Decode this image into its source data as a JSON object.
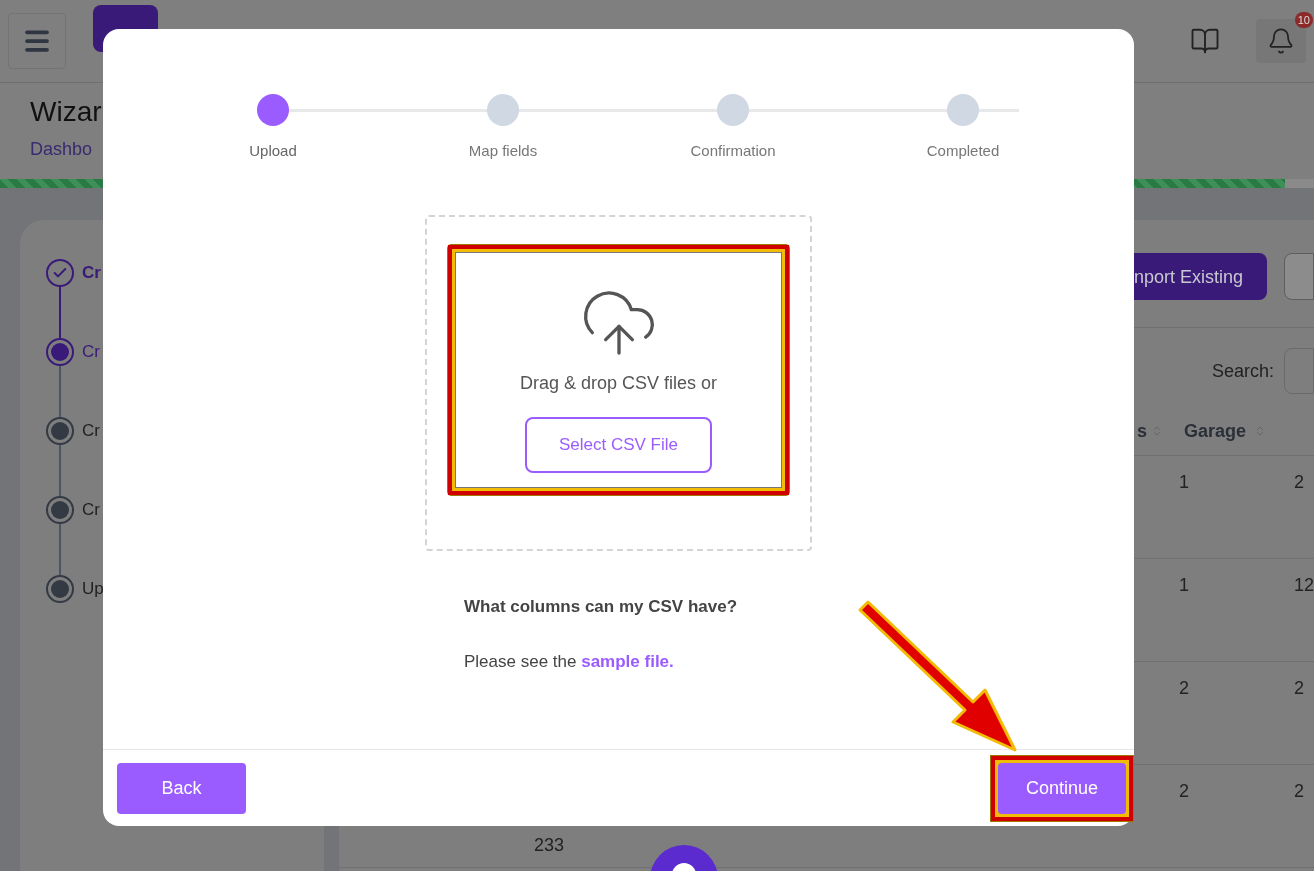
{
  "header": {
    "notification_badge": "10"
  },
  "page": {
    "title": "Wizar",
    "breadcrumb": "Dashbo",
    "progress": {
      "level": 0.978
    }
  },
  "sidebar": {
    "steps": [
      {
        "label": "Cr",
        "kind": "completed"
      },
      {
        "label": "Cr",
        "kind": "current"
      },
      {
        "label": "Cr",
        "kind": "pending"
      },
      {
        "label": "Cr",
        "kind": "pending"
      },
      {
        "label": "Up",
        "kind": "pending"
      }
    ]
  },
  "content": {
    "import_button": "nport Existing",
    "search_label": "Search:",
    "table": {
      "columns": [
        "s",
        "Garage"
      ],
      "rows": [
        {
          "column_1": "",
          "garage": "1",
          "column_3": "2"
        },
        {
          "column_1": "",
          "garage": "1",
          "column_3": "12"
        },
        {
          "column_1": "",
          "garage": "2",
          "column_3": "2"
        },
        {
          "column_1": "233",
          "garage": "2",
          "column_3": "2"
        }
      ]
    }
  },
  "modal": {
    "steps": [
      {
        "label": "Upload",
        "selected": true
      },
      {
        "label": "Map fields",
        "selected": false
      },
      {
        "label": "Confirmation",
        "selected": false
      },
      {
        "label": "Completed",
        "selected": false
      }
    ],
    "dropzone": {
      "text": "Drag & drop CSV files or",
      "button": "Select CSV File",
      "highlighted": true
    },
    "help": {
      "question": "What columns can my CSV have?",
      "text": "Please see the",
      "link": "sample file."
    },
    "footer": {
      "back": "Back",
      "continue": "Continue",
      "continue_highlighted": true
    }
  }
}
